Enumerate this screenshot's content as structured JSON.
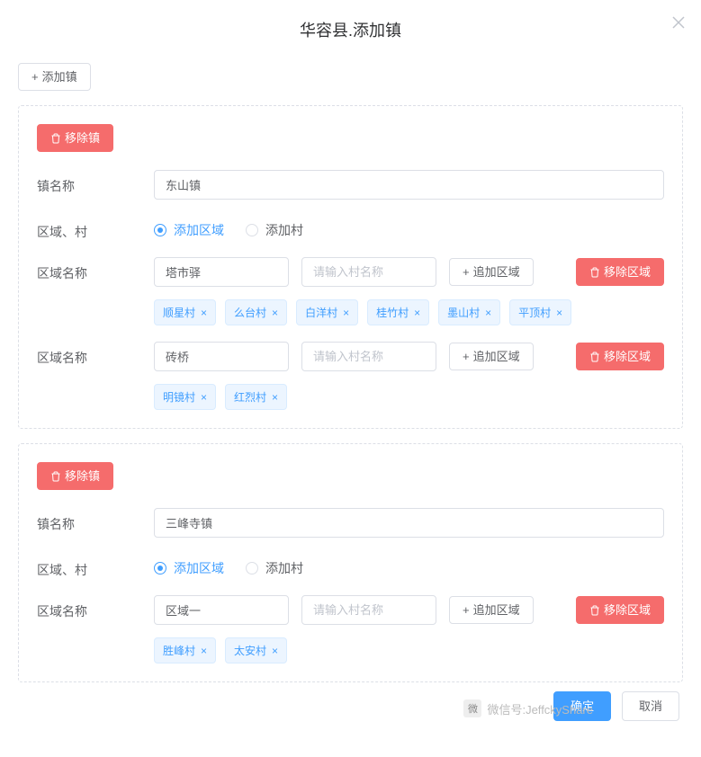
{
  "modal": {
    "title": "华容县.添加镇",
    "add_town_label": "添加镇",
    "confirm_label": "确定",
    "cancel_label": "取消"
  },
  "labels": {
    "remove_town": "移除镇",
    "town_name": "镇名称",
    "area_village": "区域、村",
    "area_name": "区域名称",
    "radio_area": "添加区域",
    "radio_village": "添加村",
    "village_placeholder": "请输入村名称",
    "append_area": "追加区域",
    "remove_area": "移除区域"
  },
  "towns": [
    {
      "name": "东山镇",
      "radio_selected": "area",
      "areas": [
        {
          "area_name": "塔市驿",
          "village_input": "",
          "tags": [
            "顺星村",
            "么台村",
            "白洋村",
            "桂竹村",
            "墨山村",
            "平顶村"
          ]
        },
        {
          "area_name": "砖桥",
          "village_input": "",
          "tags": [
            "明镜村",
            "红烈村"
          ]
        }
      ]
    },
    {
      "name": "三峰寺镇",
      "radio_selected": "area",
      "areas": [
        {
          "area_name": "区域一",
          "village_input": "",
          "tags": [
            "胜峰村",
            "太安村"
          ]
        }
      ]
    }
  ],
  "watermark": "微信号:JeffckyShare"
}
